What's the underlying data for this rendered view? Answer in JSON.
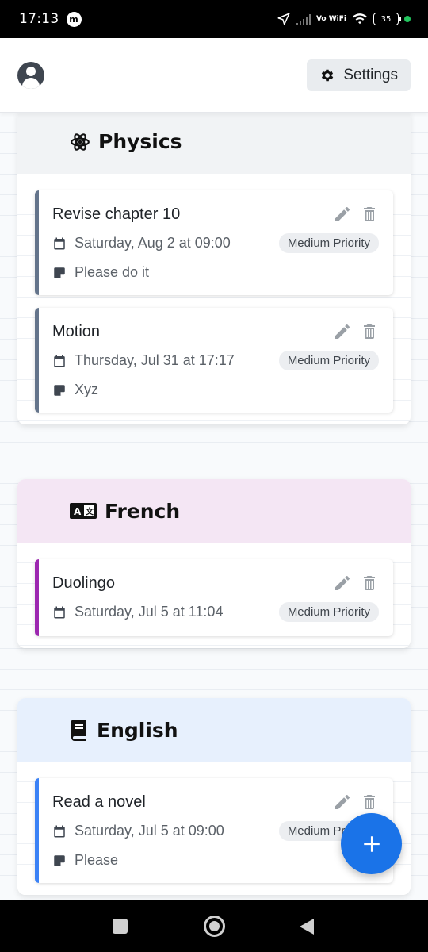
{
  "status_bar": {
    "time": "17:13",
    "carrier_badge": "m",
    "volte": "Vo WiFi",
    "battery": "35"
  },
  "header": {
    "settings_label": "Settings",
    "settings_icon": "gear-icon",
    "avatar_icon": "user-circle-icon"
  },
  "colors": {
    "physics_accent": "#64748b",
    "french_accent": "#9c27b0",
    "english_accent": "#3b82f6",
    "physics_header_bg": "#f1f3f5",
    "french_header_bg": "#f4e6f4",
    "english_header_bg": "#e7f0fd",
    "fab": "#1a73e8"
  },
  "subjects": [
    {
      "name": "Physics",
      "icon": "atom-icon",
      "tasks": [
        {
          "title": "Revise chapter 10",
          "date": "Saturday, Aug 2 at 09:00",
          "priority": "Medium Priority",
          "note": "Please do it"
        },
        {
          "title": "Motion",
          "date": "Thursday, Jul 31 at 17:17",
          "priority": "Medium Priority",
          "note": "Xyz"
        }
      ]
    },
    {
      "name": "French",
      "icon": "translate-icon",
      "tasks": [
        {
          "title": "Duolingo",
          "date": "Saturday, Jul 5 at 11:04",
          "priority": "Medium Priority"
        }
      ]
    },
    {
      "name": "English",
      "icon": "book-icon",
      "tasks": [
        {
          "title": "Read a novel",
          "date": "Saturday, Jul 5 at 09:00",
          "priority": "Medium Priority",
          "note": "Please"
        }
      ]
    }
  ],
  "fab": {
    "icon": "plus-icon"
  },
  "nav_bar": {
    "icons": [
      "recents-icon",
      "home-icon",
      "back-icon"
    ]
  }
}
